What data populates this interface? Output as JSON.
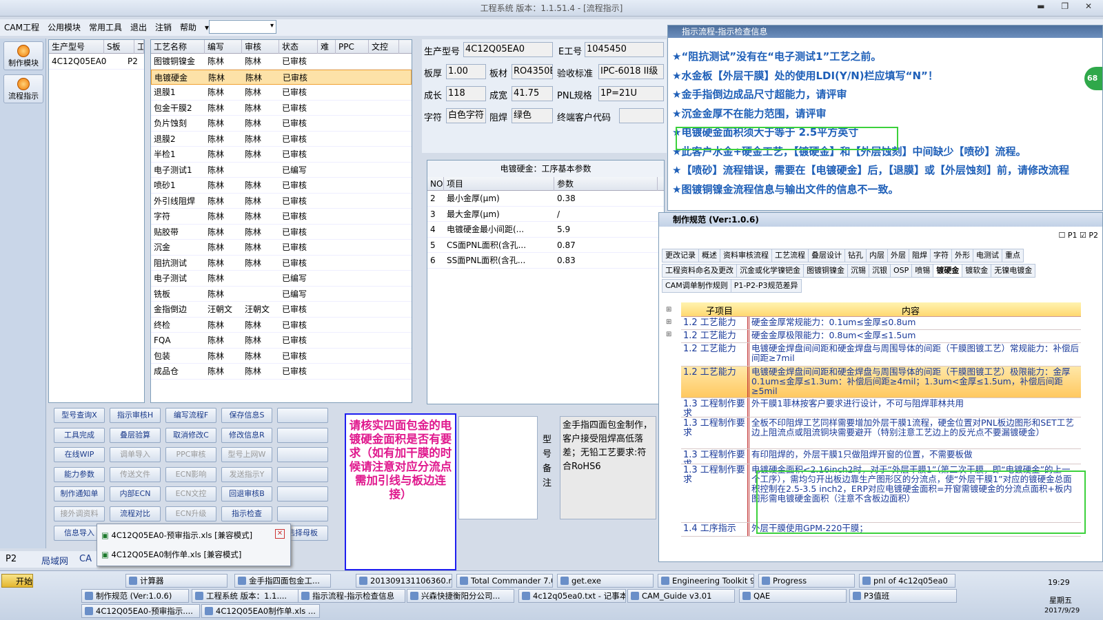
{
  "window": {
    "title": "工程系统   版本：1.1.51.4 - [流程指示]",
    "controls": "▬ ❐ ✕"
  },
  "menu": [
    "CAM工程",
    "公用模块",
    "常用工具",
    "退出",
    "注销",
    "帮助"
  ],
  "left_buttons": [
    "制作模块",
    "流程指示"
  ],
  "model_grid": {
    "headers": [
      "生产型号",
      "S板",
      "工"
    ],
    "row": [
      "4C12Q05EA0",
      "",
      "P2"
    ]
  },
  "process_grid": {
    "headers": [
      "工艺名称",
      "编写",
      "审核",
      "状态",
      "难",
      "PPC",
      "文控"
    ],
    "rows": [
      [
        "图镀铜镍金",
        "陈林",
        "陈林",
        "已审核"
      ],
      [
        "电镀硬金",
        "陈林",
        "陈林",
        "已审核"
      ],
      [
        "退膜1",
        "陈林",
        "陈林",
        "已审核"
      ],
      [
        "包金干膜2",
        "陈林",
        "陈林",
        "已审核"
      ],
      [
        "负片蚀刻",
        "陈林",
        "陈林",
        "已审核"
      ],
      [
        "退膜2",
        "陈林",
        "陈林",
        "已审核"
      ],
      [
        "半检1",
        "陈林",
        "陈林",
        "已审核"
      ],
      [
        "电子测试1",
        "陈林",
        "",
        "已编写"
      ],
      [
        "喷砂1",
        "陈林",
        "陈林",
        "已审核"
      ],
      [
        "外引线阻焊",
        "陈林",
        "陈林",
        "已审核"
      ],
      [
        "字符",
        "陈林",
        "陈林",
        "已审核"
      ],
      [
        "贴胶带",
        "陈林",
        "陈林",
        "已审核"
      ],
      [
        "沉金",
        "陈林",
        "陈林",
        "已审核"
      ],
      [
        "阻抗测试",
        "陈林",
        "陈林",
        "已审核"
      ],
      [
        "电子测试",
        "陈林",
        "",
        "已编写"
      ],
      [
        "铣板",
        "陈林",
        "",
        "已编写"
      ],
      [
        "金指倒边",
        "汪朝文",
        "汪朝文",
        "已审核"
      ],
      [
        "终检",
        "陈林",
        "陈林",
        "已审核"
      ],
      [
        "FQA",
        "陈林",
        "陈林",
        "已审核"
      ],
      [
        "包装",
        "陈林",
        "陈林",
        "已审核"
      ],
      [
        "成品仓",
        "陈林",
        "陈林",
        "已审核"
      ]
    ]
  },
  "info": {
    "prod_label": "生产型号",
    "prod": "4C12Q05EA0",
    "e_label": "E工号",
    "e": "1045450",
    "thick_label": "板厚",
    "thick": "1.00",
    "mat_label": "板材",
    "mat": "RO4350B",
    "std_label": "验收标准",
    "std": "IPC-6018 II级",
    "len_label": "成长",
    "len": "118",
    "wid_label": "成宽",
    "wid": "41.75",
    "pnl_label": "PNL规格",
    "pnl": "1P=21U",
    "char_label": "字符",
    "char": "白色字符",
    "mask_label": "阻焊",
    "mask": "绿色",
    "cust_label": "终端客户代码",
    "cust": ""
  },
  "param": {
    "title": "电镀硬金：工序基本参数",
    "headers": [
      "NO",
      "项目",
      "参数"
    ],
    "rows": [
      [
        "2",
        "最小金厚(μm)",
        "0.38"
      ],
      [
        "3",
        "最大金厚(μm)",
        "/"
      ],
      [
        "4",
        "电镀硬金最小间距(...",
        "5.9"
      ],
      [
        "5",
        "CS面PNL面积(含孔...",
        "0.87"
      ],
      [
        "6",
        "SS面PNL面积(含孔...",
        "0.83"
      ]
    ]
  },
  "buttons": [
    [
      "型号查询X",
      "指示审核H",
      "编写流程F",
      "保存信息S",
      ""
    ],
    [
      "工具完成",
      "叠层验算",
      "取消修改C",
      "修改信息R",
      ""
    ],
    [
      "在线WIP",
      "调单导入",
      "PPC审核",
      "型号上网W",
      ""
    ],
    [
      "能力参数",
      "传送文件",
      "ECN影响",
      "发送指示Y",
      ""
    ],
    [
      "制作通知单",
      "内部ECN",
      "ECN文控",
      "回退审核B",
      ""
    ],
    [
      "接外调资料",
      "流程对比",
      "ECN升级",
      "指示检查",
      ""
    ],
    [
      "信息导入",
      "",
      "",
      "",
      "选择母板"
    ]
  ],
  "disabled_buttons": [
    "调单导入",
    "PPC审核",
    "型号上网W",
    "传送文件",
    "ECN影响",
    "发送指示Y",
    "ECN文控",
    "接外调资料",
    "ECN升级"
  ],
  "note": {
    "text": "请核实四面包金的电镀硬金面积是否有要求（如有加干膜的时候请注意对应分流点需加引线与板边连接）",
    "label": "型号备注",
    "remark": "金手指四面包金制作，客户接受阻焊高低落差；无铅工艺要求:符合RoHS6"
  },
  "popup": {
    "items": [
      "4C12Q05EA0-预审指示.xls [兼容模式]",
      "4C12Q05EA0制作单.xls [兼容模式]"
    ]
  },
  "status": {
    "plant": "P2",
    "net": "局域网",
    "ca": "CA"
  },
  "flow": {
    "title": "指示流程-指示检查信息",
    "badge": "68",
    "lines": [
      "★“阻抗测试”没有在“电子测试1”工艺之前。",
      "★水金板【外层干膜】处的使用LDI(Y/N)栏应填写“N”！",
      "★金手指倒边成品尺寸超能力，请评审",
      "★沉金金厚不在能力范围，请评审",
      "★电镀硬金面积须大于等于 2.5平方英寸",
      "★此客户水金+硬金工艺，【镀硬金】和【外层蚀刻】中间缺少【喷砂】流程。",
      "★【喷砂】流程错误，需要在【电镀硬金】后，【退膜】或【外层蚀刻】前，请修改流程",
      "★图镀铜镍金流程信息与输出文件的信息不一致。"
    ]
  },
  "spec": {
    "title": "制作规范 (Ver:1.0.6)",
    "checks": [
      "P1",
      "P2"
    ],
    "tabs1": [
      "更改记录",
      "概述",
      "资料审核流程",
      "工艺流程",
      "叠层设计",
      "钻孔",
      "内层",
      "外层",
      "阻焊",
      "字符",
      "外形",
      "电测试",
      "重点"
    ],
    "tabs2": [
      "工程资料命名及更改",
      "沉金或化学镍钯金",
      "图镀铜镍金",
      "沉锡",
      "沉银",
      "OSP",
      "喷锡",
      "镀硬金",
      "镀软金",
      "无镍电镀金"
    ],
    "tabs3": [
      "CAM调单制作规则",
      "P1-P2-P3规范差异"
    ],
    "headers": [
      "子项目",
      "内容"
    ],
    "rows": [
      [
        "1.2 工艺能力",
        "硬金金厚常规能力：0.1um≤金厚≤0.8um"
      ],
      [
        "1.2 工艺能力",
        "硬金金厚极限能力：0.8um<金厚≤1.5um"
      ],
      [
        "1.2 工艺能力",
        "电镀硬金焊盘间间距和硬金焊盘与周围导体的间距（干膜图镀工艺）常规能力：补偿后间距≥7mil"
      ],
      [
        "1.2 工艺能力",
        "电镀硬金焊盘间间距和硬金焊盘与周围导体的间距（干膜图镀工艺）极限能力：金厚0.1um≤金厚≤1.3um：补偿后间距≥4mil；1.3um<金厚≤1.5um，补偿后间距≥5mil"
      ],
      [
        "1.3 工程制作要求",
        "外干膜1菲林按客户要求进行设计，不可与阻焊菲林共用"
      ],
      [
        "1.3 工程制作要求",
        "全板不印阻焊工艺同样需要增加外层干膜1流程，硬金位置对PNL板边图形和SET工艺边上阻流点或阻流铜块需要避开（特别注意工艺边上的反光点不要漏镀硬金）"
      ],
      [
        "1.3 工程制作要求",
        "有印阻焊的，外层干膜1只做阻焊开窗的位置，不需要板做"
      ],
      [
        "1.3 工程制作要求",
        "电镀硬金面积<2.16inch2时，对于“外层干膜1”（第二次干膜，即“电镀硬金”的上一个工序），需均匀开出板边靠生产图形区的分流点，使“外层干膜1”对应的镀硬金总面积控制在2.5-3.5 inch2，ERP对应电镀硬金面积=开窗需镀硬金的分流点面积+板内图形需电镀硬金面积（注意不含板边面积）"
      ],
      [
        "1.4 工序指示",
        "外层干膜使用GPM-220干膜；"
      ]
    ]
  },
  "taskbar": {
    "start": "开始",
    "calc": "计算器",
    "clock": "19:29",
    "weekday": "星期五",
    "date": "2017/9/29",
    "row1": [
      "金手指四面包金工...",
      "201309131106360.rt...",
      "Total Commander 7.0...",
      "get.exe",
      "Engineering Toolkit 9....",
      "Progress",
      "pnl of 4c12q05ea0"
    ],
    "row2": [
      "制作规范 (Ver:1.0.6)",
      "工程系统   版本：1.1....",
      "指示流程-指示检查信息",
      "兴森快捷衡阳分公司...",
      "4c12q05ea0.txt - 记事本",
      "CAM_Guide v3.01",
      "QAE",
      "P3值班"
    ],
    "row3": [
      "4C12Q05EA0-预审指示....",
      "4C12Q05EA0制作单.xls ..."
    ]
  }
}
